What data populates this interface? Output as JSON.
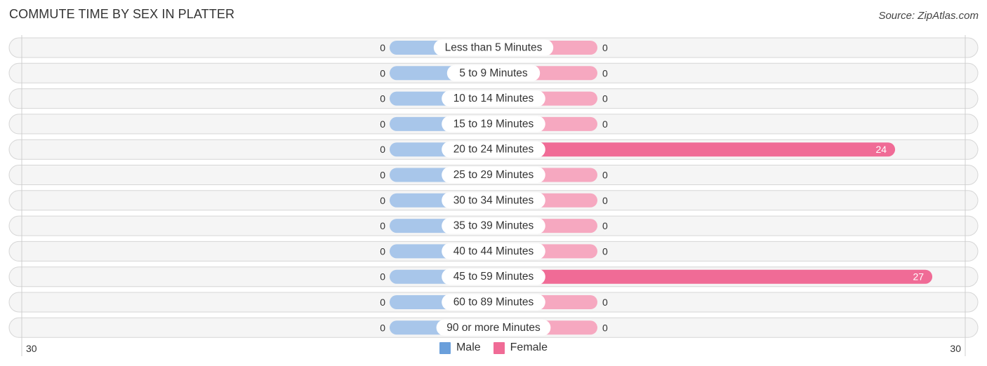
{
  "title": "COMMUTE TIME BY SEX IN PLATTER",
  "source": "Source: ZipAtlas.com",
  "colors": {
    "male": "#6a9fdb",
    "male_bar": "#a8c6ea",
    "female": "#f06b96",
    "female_bar_light": "#f6a8c0"
  },
  "legend": {
    "male_label": "Male",
    "female_label": "Female"
  },
  "axis": {
    "left_tick": "30",
    "right_tick": "30"
  },
  "chart_data": {
    "type": "bar",
    "orientation": "horizontal-diverging",
    "title": "COMMUTE TIME BY SEX IN PLATTER",
    "xlabel": "",
    "ylabel": "",
    "xlim": [
      -30,
      30
    ],
    "legend_position": "bottom-center",
    "grid": false,
    "categories": [
      "Less than 5 Minutes",
      "5 to 9 Minutes",
      "10 to 14 Minutes",
      "15 to 19 Minutes",
      "20 to 24 Minutes",
      "25 to 29 Minutes",
      "30 to 34 Minutes",
      "35 to 39 Minutes",
      "40 to 44 Minutes",
      "45 to 59 Minutes",
      "60 to 89 Minutes",
      "90 or more Minutes"
    ],
    "series": [
      {
        "name": "Male",
        "side": "left",
        "values": [
          0,
          0,
          0,
          0,
          0,
          0,
          0,
          0,
          0,
          0,
          0,
          0
        ]
      },
      {
        "name": "Female",
        "side": "right",
        "values": [
          0,
          0,
          0,
          0,
          24,
          0,
          0,
          0,
          0,
          27,
          0,
          0
        ]
      }
    ],
    "tick_labels": [
      "30",
      "30"
    ]
  }
}
